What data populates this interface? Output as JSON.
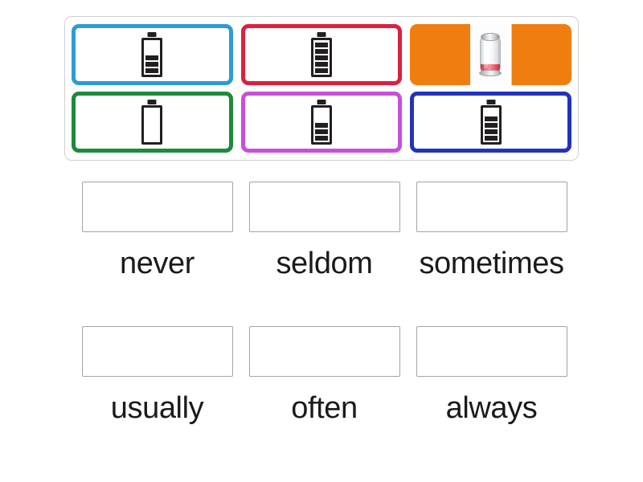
{
  "activity": {
    "type": "match-up-drag-and-drop",
    "topic": "adverbs-of-frequency-battery-levels"
  },
  "tile_tray": {
    "name": "draggable-tiles",
    "tiles": [
      {
        "id": "tile-1",
        "icon": "battery-three-bars-icon",
        "icon_style": "flat",
        "border_color": "#2E9BD6",
        "background_color": "#FFFFFF",
        "battery_slots": 5,
        "battery_filled_bars": 3
      },
      {
        "id": "tile-2",
        "icon": "battery-full-icon",
        "icon_style": "flat",
        "border_color": "#DC2040",
        "background_color": "#FFFFFF",
        "battery_slots": 5,
        "battery_filled_bars": 5
      },
      {
        "id": "tile-3",
        "icon": "battery-low-photo-icon",
        "icon_style": "photo",
        "border_color": "#F07D10",
        "background_color": "#F07D10",
        "battery_slots": 5,
        "battery_filled_bars": 1
      },
      {
        "id": "tile-4",
        "icon": "battery-empty-icon",
        "icon_style": "flat",
        "border_color": "#1E8A3C",
        "background_color": "#FFFFFF",
        "battery_slots": 5,
        "battery_filled_bars": 0
      },
      {
        "id": "tile-5",
        "icon": "battery-two-bars-icon",
        "icon_style": "flat",
        "border_color": "#C84FD8",
        "background_color": "#FFFFFF",
        "battery_slots": 5,
        "battery_filled_bars": 3
      },
      {
        "id": "tile-6",
        "icon": "battery-four-bars-icon",
        "icon_style": "flat",
        "border_color": "#2233BB",
        "background_color": "#FFFFFF",
        "battery_slots": 5,
        "battery_filled_bars": 4
      }
    ]
  },
  "answers": {
    "name": "answer-slots",
    "items": [
      {
        "id": "answer-1",
        "label": "never",
        "drop_zone_value": ""
      },
      {
        "id": "answer-2",
        "label": "seldom",
        "drop_zone_value": ""
      },
      {
        "id": "answer-3",
        "label": "sometimes",
        "drop_zone_value": ""
      },
      {
        "id": "answer-4",
        "label": "usually",
        "drop_zone_value": ""
      },
      {
        "id": "answer-5",
        "label": "often",
        "drop_zone_value": ""
      },
      {
        "id": "answer-6",
        "label": "always",
        "drop_zone_value": ""
      }
    ]
  },
  "colors": {
    "tray_border": "#CFCFCF",
    "drop_zone_border": "#A3A3A3",
    "label_text": "#1A1A1A",
    "page_background": "#FFFFFF",
    "battery_glyph": "#231F20"
  }
}
